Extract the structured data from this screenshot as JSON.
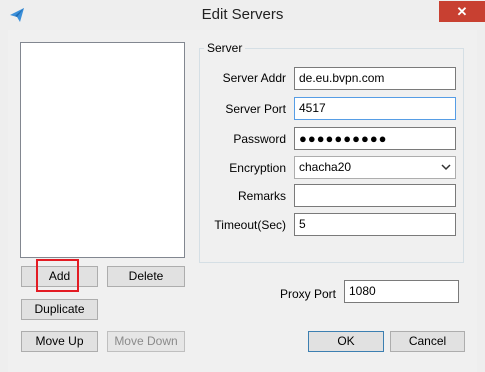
{
  "window": {
    "title": "Edit Servers",
    "close_glyph": "✕"
  },
  "buttons": {
    "add": "Add",
    "delete": "Delete",
    "duplicate": "Duplicate",
    "move_up": "Move Up",
    "move_down": "Move Down",
    "ok": "OK",
    "cancel": "Cancel"
  },
  "server_group": {
    "title": "Server",
    "fields": {
      "addr_label": "Server Addr",
      "addr_value": "de.eu.bvpn.com",
      "port_label": "Server Port",
      "port_value": "4517",
      "password_label": "Password",
      "password_value": "●●●●●●●●●●",
      "encryption_label": "Encryption",
      "encryption_value": "chacha20",
      "remarks_label": "Remarks",
      "remarks_value": "",
      "timeout_label": "Timeout(Sec)",
      "timeout_value": "5"
    }
  },
  "proxy": {
    "label": "Proxy Port",
    "value": "1080"
  },
  "icons": {
    "app": "paper-plane-icon",
    "close": "close-icon",
    "dropdown": "chevron-down-icon"
  },
  "colors": {
    "close_bg": "#c84031",
    "highlight": "#e31b23",
    "app_icon": "#3b8fd9"
  }
}
